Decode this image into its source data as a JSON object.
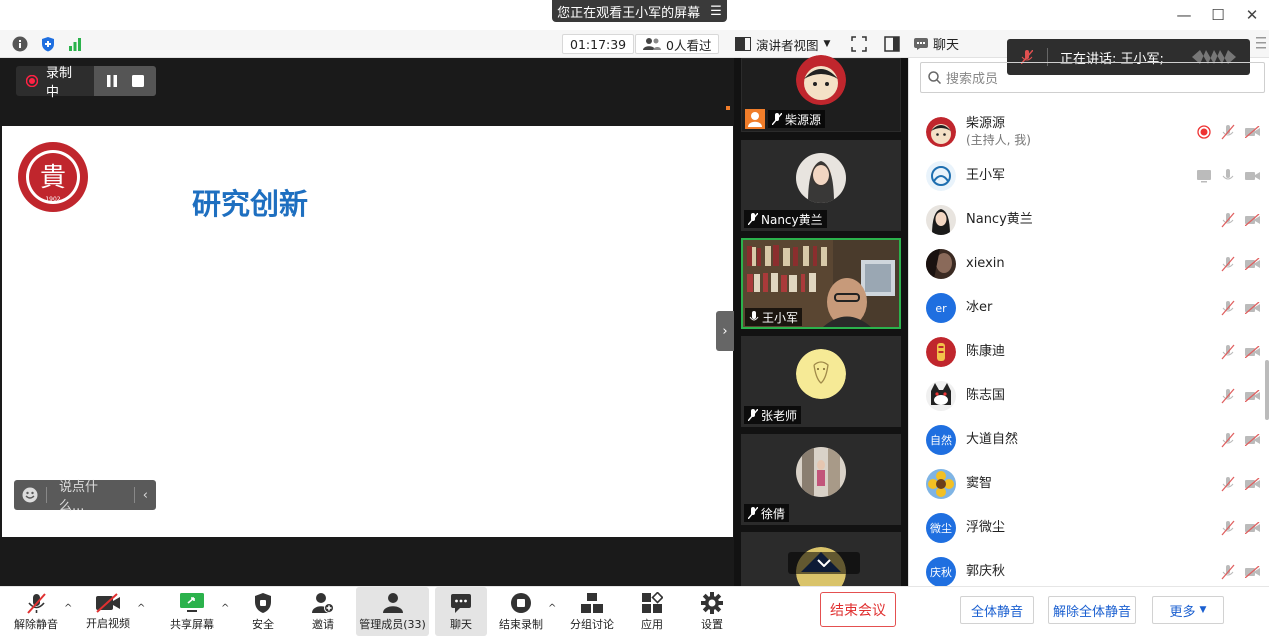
{
  "banner": {
    "text": "您正在观看王小军的屏幕",
    "menu_glyph": "☰"
  },
  "window": {
    "minimize": "—",
    "maximize": "☐",
    "close": "✕"
  },
  "toolbar": {
    "timer": "01:17:39",
    "viewers": "0人看过",
    "view_mode": "演讲者视图"
  },
  "recording": {
    "label": "录制中"
  },
  "slide": {
    "title": "研究创新",
    "logo_year": "1902",
    "logo_char": "貴"
  },
  "say": {
    "placeholder": "说点什么..."
  },
  "tiles": [
    {
      "name": "柴源源"
    },
    {
      "name": "Nancy黄兰"
    },
    {
      "name": "王小军"
    },
    {
      "name": "张老师"
    },
    {
      "name": "徐倩"
    }
  ],
  "chat": {
    "title": "聊天"
  },
  "speaking": {
    "text": "正在讲话: 王小军;"
  },
  "search": {
    "placeholder": "搜索成员"
  },
  "members": [
    {
      "name": "柴源源",
      "sub": "(主持人, 我)",
      "avatar": "cartoon"
    },
    {
      "name": "王小军",
      "sub": "",
      "avatar": "logo"
    },
    {
      "name": "Nancy黄兰",
      "sub": "",
      "avatar": "photo"
    },
    {
      "name": "xiexin",
      "sub": "",
      "avatar": "dark"
    },
    {
      "name": "冰er",
      "sub": "",
      "avatar": "text",
      "initials": "er",
      "color": "#1f6fe0"
    },
    {
      "name": "陈康迪",
      "sub": "",
      "avatar": "red"
    },
    {
      "name": "陈志国",
      "sub": "",
      "avatar": "cat"
    },
    {
      "name": "大道自然",
      "sub": "",
      "avatar": "text",
      "initials": "自然",
      "color": "#1f6fe0"
    },
    {
      "name": "窦智",
      "sub": "",
      "avatar": "flower"
    },
    {
      "name": "浮微尘",
      "sub": "",
      "avatar": "text",
      "initials": "微尘",
      "color": "#1f6fe0"
    },
    {
      "name": "郭庆秋",
      "sub": "",
      "avatar": "text",
      "initials": "庆秋",
      "color": "#1f6fe0"
    }
  ],
  "bottom": {
    "unmute": "解除静音",
    "video": "开启视频",
    "share": "共享屏幕",
    "security": "安全",
    "invite": "邀请",
    "manage": "管理成员(33)",
    "chat": "聊天",
    "end_record": "结束录制",
    "breakout": "分组讨论",
    "apps": "应用",
    "settings": "设置",
    "end_meeting": "结束会议"
  },
  "panel_actions": {
    "mute_all": "全体静音",
    "unmute_all": "解除全体静音",
    "more": "更多"
  }
}
